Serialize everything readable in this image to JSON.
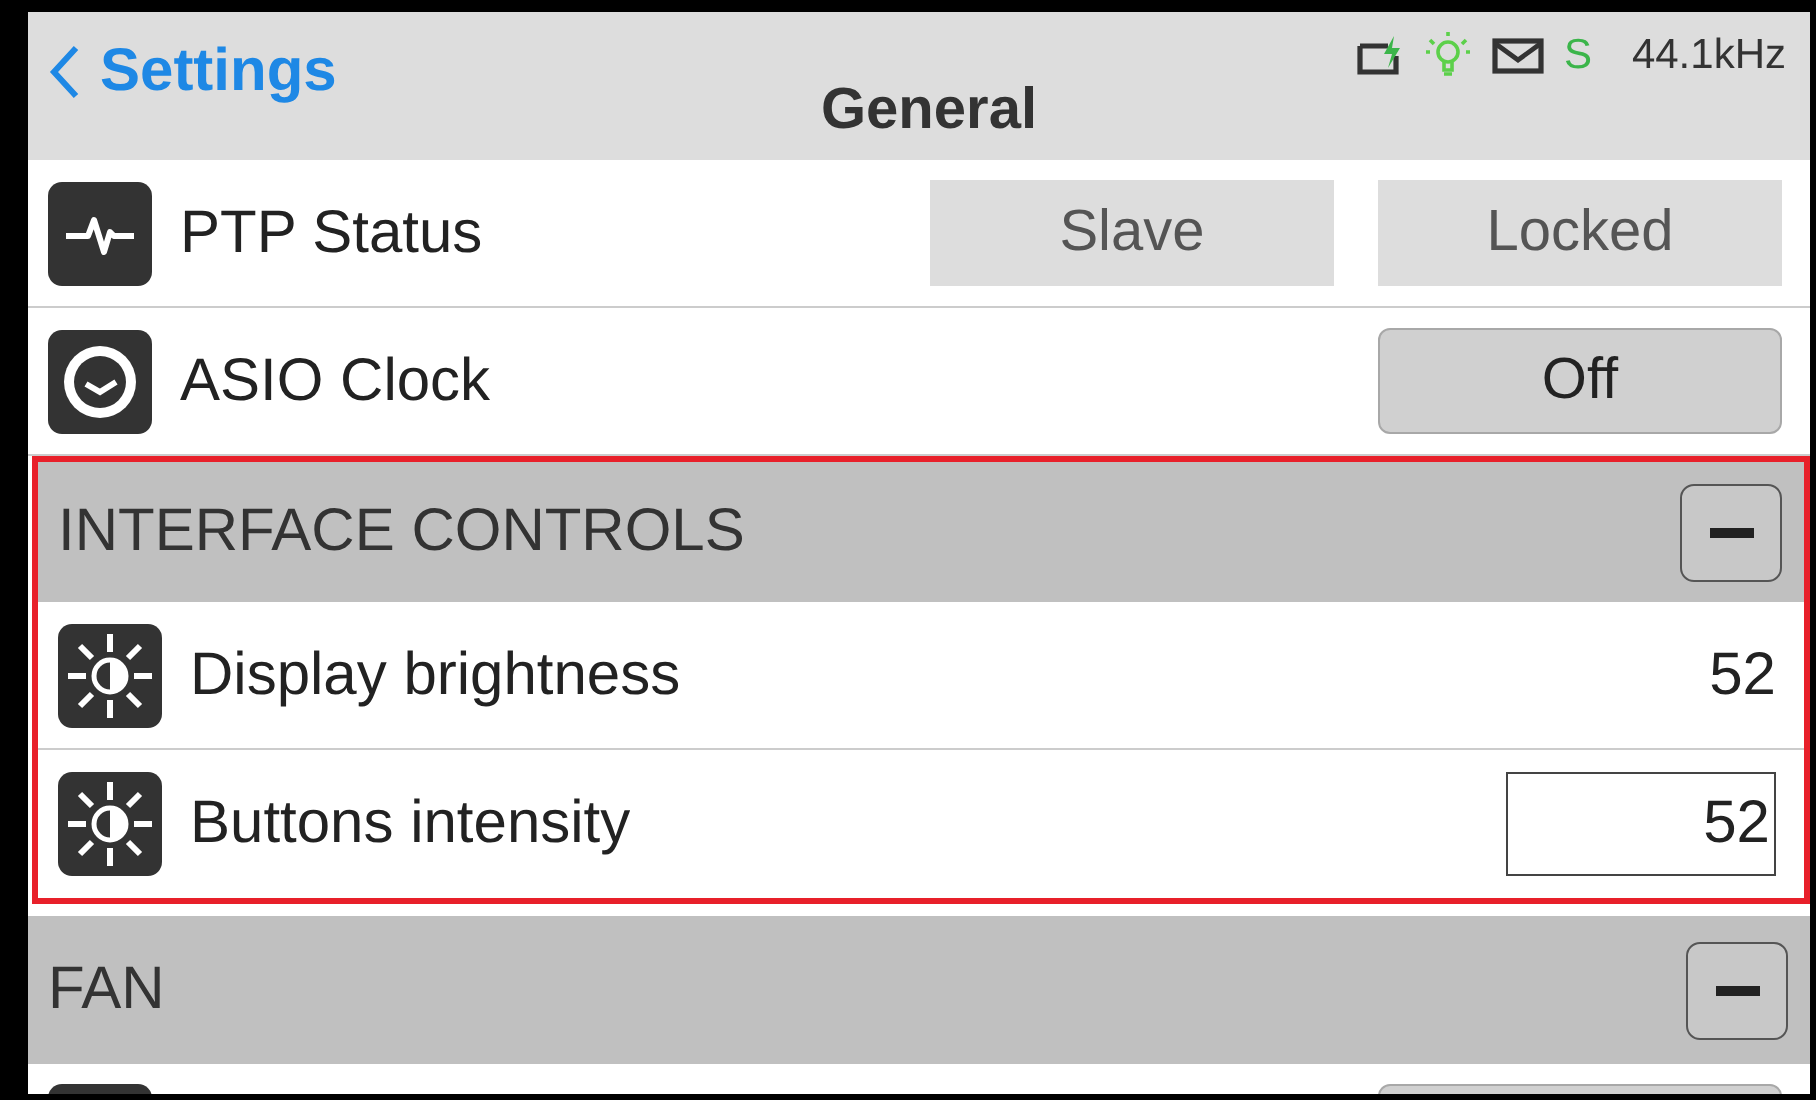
{
  "header": {
    "back": "Settings",
    "title": "General",
    "status": {
      "indicator": "S",
      "sample_rate": "44.1kHz"
    }
  },
  "rows": [
    {
      "kind": "status",
      "label": "PTP Status",
      "values": [
        "Slave",
        "Locked"
      ]
    },
    {
      "kind": "button",
      "label": "ASIO Clock",
      "value": "Off"
    }
  ],
  "sections": [
    {
      "title": "INTERFACE CONTROLS",
      "expanded": true,
      "highlighted": true,
      "rows": [
        {
          "kind": "value",
          "label": "Display brightness",
          "value": "52"
        },
        {
          "kind": "field",
          "label": "Buttons intensity",
          "value": "52"
        }
      ]
    },
    {
      "title": "FAN",
      "expanded": true,
      "highlighted": false,
      "rows": [
        {
          "kind": "partial"
        }
      ]
    }
  ]
}
